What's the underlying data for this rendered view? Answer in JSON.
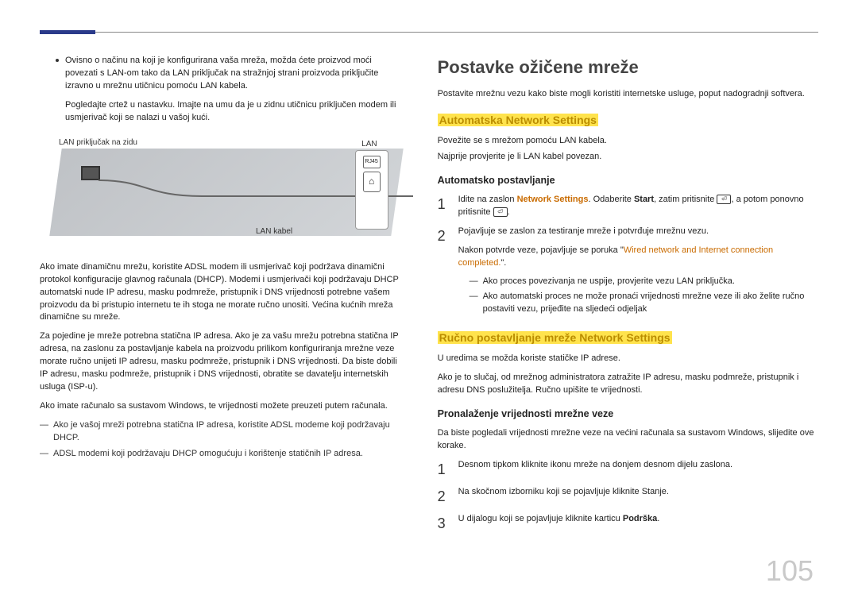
{
  "page_number": "105",
  "left": {
    "intro_bullet": "Ovisno o načinu na koji je konfigurirana vaša mreža, možda ćete proizvod moći povezati s LAN-om tako da LAN priključak na stražnjoj strani proizvoda priključite izravno u mrežnu utičnicu pomoću LAN kabela.",
    "intro_note": "Pogledajte crtež u nastavku. Imajte na umu da je u zidnu utičnicu priključen modem ili usmjerivač koji se nalazi u vašoj kući.",
    "figure": {
      "wall_label": "LAN priključak na zidu",
      "lan_label": "LAN",
      "rj45": "RJ45",
      "cable_label": "LAN kabel"
    },
    "p1": "Ako imate dinamičnu mrežu, koristite ADSL modem ili usmjerivač koji podržava dinamični protokol konfiguracije glavnog računala (DHCP). Modemi i usmjerivači koji podržavaju DHCP automatski nude IP adresu, masku podmreže, pristupnik i DNS vrijednosti potrebne vašem proizvodu da bi pristupio internetu te ih stoga ne morate ručno unositi. Većina kućnih mreža dinamične su mreže.",
    "p2": "Za pojedine je mreže potrebna statična IP adresa. Ako je za vašu mrežu potrebna statična IP adresa, na zaslonu za postavljanje kabela na proizvodu prilikom konfiguriranja mrežne veze morate ručno unijeti IP adresu, masku podmreže, pristupnik i DNS vrijednosti. Da biste dobili IP adresu, masku podmreže, pristupnik i DNS vrijednosti, obratite se davatelju internetskih usluga (ISP-u).",
    "p3": "Ako imate računalo sa sustavom Windows, te vrijednosti možete preuzeti putem računala.",
    "n1": "Ako je vašoj mreži potrebna statična IP adresa, koristite ADSL modeme koji podržavaju DHCP.",
    "n2": "ADSL modemi koji podržavaju DHCP omogućuju i korištenje statičnih IP adresa."
  },
  "right": {
    "title": "Postavke ožičene mreže",
    "intro": "Postavite mrežnu vezu kako biste mogli koristiti internetske usluge, poput nadogradnji softvera.",
    "auto_heading": "Automatska Network Settings",
    "auto_p1": "Povežite se s mrežom pomoću LAN kabela.",
    "auto_p2": "Najprije provjerite je li LAN kabel povezan.",
    "auto_sub": "Automatsko postavljanje",
    "step1_a": "Idite na zaslon ",
    "step1_ns": "Network Settings",
    "step1_b": ". Odaberite ",
    "step1_start": "Start",
    "step1_c": ", zatim pritisnite ",
    "step1_d": ", a potom ponovno pritisnite ",
    "step1_e": ".",
    "step2": "Pojavljuje se zaslon za testiranje mreže i potvrđuje mrežnu vezu.",
    "step2_after_pre": "Nakon potvrde veze, pojavljuje se poruka \"",
    "step2_after_msg": "Wired network and Internet connection completed.",
    "step2_after_post": "\".",
    "note_a": "Ako proces povezivanja ne uspije, provjerite vezu LAN priključka.",
    "note_b": "Ako automatski proces ne može pronaći vrijednosti mrežne veze ili ako želite ručno postaviti vezu, prijeđite na sljedeći odjeljak",
    "manual_heading": "Ručno postavljanje mreže Network Settings",
    "manual_p1": "U uredima se možda koriste statičke IP adrese.",
    "manual_p2": "Ako je to slučaj, od mrežnog administratora zatražite IP adresu, masku podmreže, pristupnik i adresu DNS poslužitelja. Ručno upišite te vrijednosti.",
    "find_sub": "Pronalaženje vrijednosti mrežne veze",
    "find_intro": "Da biste pogledali vrijednosti mrežne veze na većini računala sa sustavom Windows, slijedite ove korake.",
    "f1": "Desnom tipkom kliknite ikonu mreže na donjem desnom dijelu zaslona.",
    "f2": "Na skočnom izborniku koji se pojavljuje kliknite Stanje.",
    "f3_a": "U dijalogu koji se pojavljuje kliknite karticu ",
    "f3_b": "Podrška",
    "f3_c": "."
  }
}
